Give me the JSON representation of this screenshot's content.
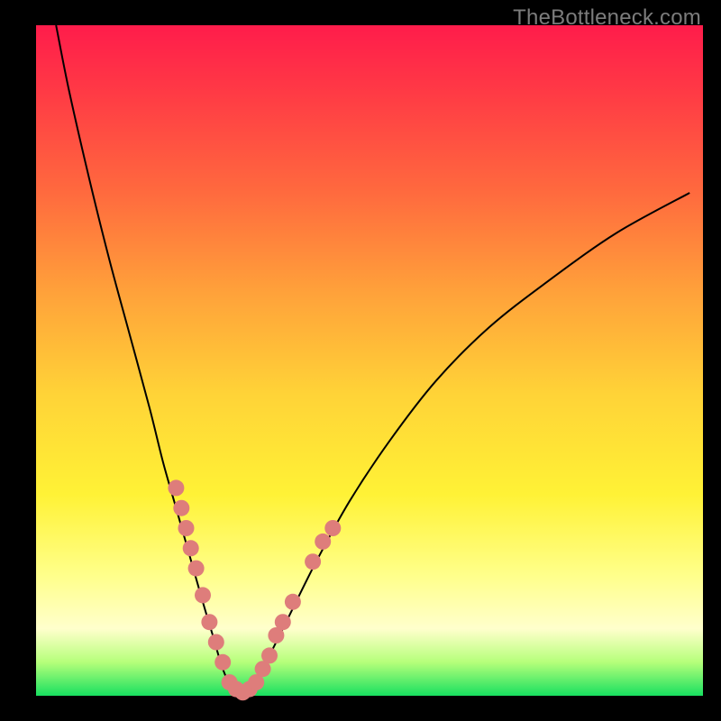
{
  "watermark": "TheBottleneck.com",
  "colors": {
    "page_bg": "#000000",
    "gradient_top": "#ff1c4b",
    "gradient_bottom": "#18e060",
    "curve": "#000000",
    "dot": "#de7d7b",
    "watermark": "#7c7c7c"
  },
  "chart_data": {
    "type": "line",
    "title": "",
    "xlabel": "",
    "ylabel": "",
    "xlim": [
      0,
      100
    ],
    "ylim": [
      0,
      100
    ],
    "grid": false,
    "legend": false,
    "series": [
      {
        "name": "bottleneck-curve",
        "x": [
          3,
          5,
          8,
          11,
          14,
          17,
          19,
          21,
          23,
          25,
          26.5,
          28,
          29.5,
          31,
          33,
          35,
          38,
          42,
          47,
          53,
          60,
          68,
          77,
          87,
          98
        ],
        "y": [
          100,
          90,
          77,
          65,
          54,
          43,
          35,
          28,
          21,
          14,
          9,
          4,
          1,
          0.5,
          2,
          6,
          12,
          20,
          29,
          38,
          47,
          55,
          62,
          69,
          75
        ]
      }
    ],
    "points": [
      {
        "name": "left-cluster",
        "x": 21.0,
        "y": 31
      },
      {
        "name": "left-cluster",
        "x": 21.8,
        "y": 28
      },
      {
        "name": "left-cluster",
        "x": 22.5,
        "y": 25
      },
      {
        "name": "left-cluster",
        "x": 23.2,
        "y": 22
      },
      {
        "name": "left-cluster",
        "x": 24.0,
        "y": 19
      },
      {
        "name": "left-cluster",
        "x": 25.0,
        "y": 15
      },
      {
        "name": "left-cluster",
        "x": 26.0,
        "y": 11
      },
      {
        "name": "left-cluster",
        "x": 27.0,
        "y": 8
      },
      {
        "name": "left-cluster",
        "x": 28.0,
        "y": 5
      },
      {
        "name": "bottom",
        "x": 29.0,
        "y": 2
      },
      {
        "name": "bottom",
        "x": 30.0,
        "y": 1
      },
      {
        "name": "bottom",
        "x": 31.0,
        "y": 0.5
      },
      {
        "name": "bottom",
        "x": 32.0,
        "y": 1
      },
      {
        "name": "bottom",
        "x": 33.0,
        "y": 2
      },
      {
        "name": "right-cluster",
        "x": 34.0,
        "y": 4
      },
      {
        "name": "right-cluster",
        "x": 35.0,
        "y": 6
      },
      {
        "name": "right-cluster",
        "x": 36.0,
        "y": 9
      },
      {
        "name": "right-cluster",
        "x": 37.0,
        "y": 11
      },
      {
        "name": "right-cluster",
        "x": 38.5,
        "y": 14
      },
      {
        "name": "right-upper",
        "x": 41.5,
        "y": 20
      },
      {
        "name": "right-upper",
        "x": 43.0,
        "y": 23
      },
      {
        "name": "right-upper",
        "x": 44.5,
        "y": 25
      }
    ]
  }
}
